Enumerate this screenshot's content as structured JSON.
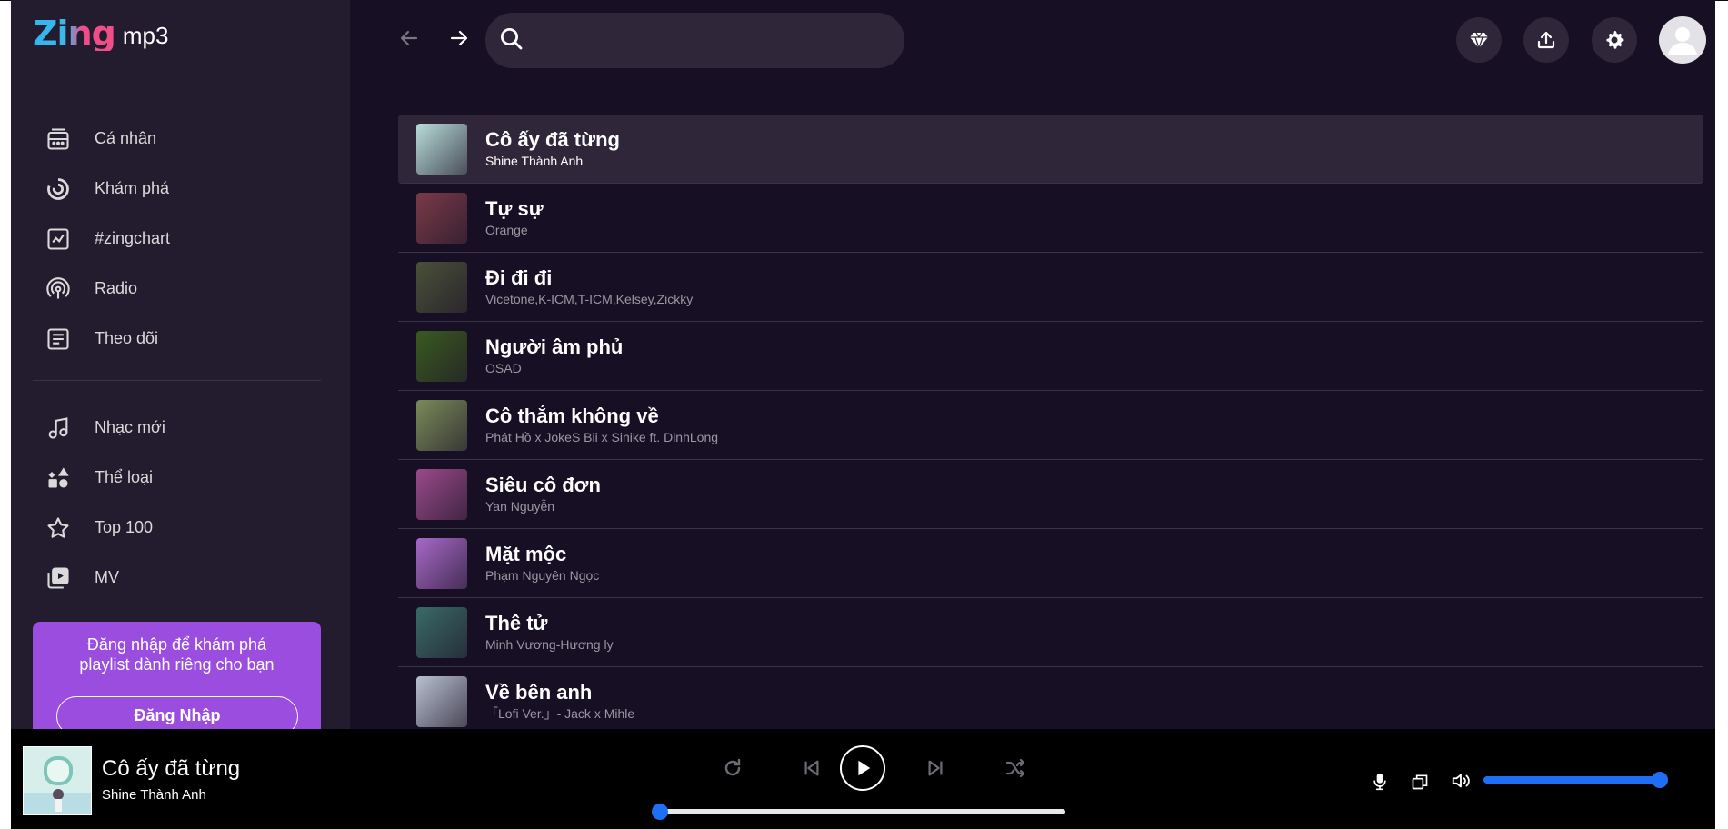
{
  "app": {
    "logo_zing": "Zing",
    "logo_mp3": "mp3"
  },
  "colors": {
    "background": "#170f23",
    "sidebar": "#231b2e",
    "accent_purple": "#9b4de0",
    "player_accent": "#1e6ff5"
  },
  "sidebar": {
    "nav_primary": [
      {
        "label": "Cá nhân",
        "icon": "library-icon"
      },
      {
        "label": "Khám phá",
        "icon": "discover-icon"
      },
      {
        "label": "#zingchart",
        "icon": "chart-icon"
      },
      {
        "label": "Radio",
        "icon": "radio-icon"
      },
      {
        "label": "Theo dõi",
        "icon": "feed-icon"
      }
    ],
    "nav_secondary": [
      {
        "label": "Nhạc mới",
        "icon": "music-note-icon"
      },
      {
        "label": "Thể loại",
        "icon": "category-icon"
      },
      {
        "label": "Top 100",
        "icon": "star-icon"
      },
      {
        "label": "MV",
        "icon": "video-icon"
      }
    ],
    "login_prompt": {
      "line1": "Đăng nhập để khám phá",
      "line2": "playlist dành riêng cho bạn",
      "button": "Đăng Nhập"
    }
  },
  "header": {
    "search_value": "",
    "buttons": [
      "back-arrow-icon",
      "forward-arrow-icon",
      "diamond-icon",
      "upload-icon",
      "settings-icon",
      "user-avatar-icon"
    ]
  },
  "songs": [
    {
      "title": "Cô ấy đã từng",
      "artist": "Shine Thành Anh",
      "active": true,
      "art": "#b8dcd9"
    },
    {
      "title": "Tự sự",
      "artist": "Orange",
      "active": false,
      "art": "#7a3a48"
    },
    {
      "title": "Đi đi đi",
      "artist": "Vicetone,K-ICM,T-ICM,Kelsey,Zickky",
      "active": false,
      "art": "#4a5038"
    },
    {
      "title": "Người âm phủ",
      "artist": "OSAD",
      "active": false,
      "art": "#3a5a20"
    },
    {
      "title": "Cô thắm không về",
      "artist": "Phát Hồ x JokeS Bii x Sinike ft. DinhLong",
      "active": false,
      "art": "#7a8a58"
    },
    {
      "title": "Siêu cô đơn",
      "artist": "Yan Nguyễn",
      "active": false,
      "art": "#9a4a8a"
    },
    {
      "title": "Mặt mộc",
      "artist": "Phạm Nguyên Ngọc",
      "active": false,
      "art": "#a868c8"
    },
    {
      "title": "Thê tử",
      "artist": "Minh Vương-Hương ly",
      "active": false,
      "art": "#3a6a68"
    },
    {
      "title": "Về bên anh",
      "artist": "「Lofi Ver.」- Jack x Mihle",
      "active": false,
      "art": "#b8c0d0"
    }
  ],
  "player": {
    "title": "Cô ấy đã từng",
    "artist": "Shine Thành Anh",
    "progress": 0.0,
    "volume": 1.0,
    "controls": [
      "repeat-icon",
      "previous-icon",
      "play-icon",
      "next-icon",
      "shuffle-icon"
    ],
    "extras": [
      "karaoke-mic-icon",
      "mini-player-icon",
      "volume-icon"
    ]
  }
}
